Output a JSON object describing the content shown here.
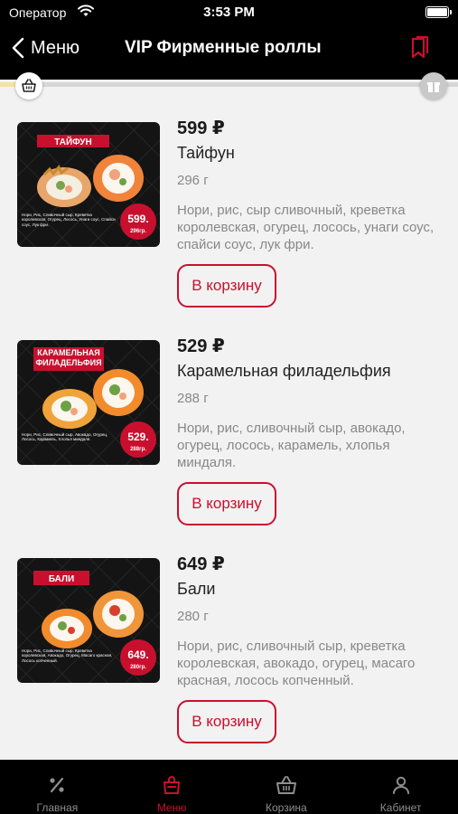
{
  "status_bar": {
    "carrier": "Оператор",
    "time": "3:53 PM"
  },
  "nav": {
    "back_label": "Меню",
    "title": "VIP Фирменные роллы"
  },
  "progress": {
    "fraction": 0.04
  },
  "accent_color": "#c8102e",
  "products": [
    {
      "price": "599 ₽",
      "name": "Тайфун",
      "weight": "296 г",
      "description": "Нори, рис, сыр сливочный, креветка королевская, огурец, лосось, унаги соус, спайси соус, лук фри.",
      "button": "В корзину",
      "image": {
        "banner": "ТАЙФУН",
        "price_badge": "599.",
        "weight_badge": "296гр.",
        "composition": "Нори, Рис, Сливочный сыр, Креветка королевская, Огурец, Лосось, Унаги соус, Спайси соус, Лук фри."
      }
    },
    {
      "price": "529 ₽",
      "name": "Карамельная филадельфия",
      "weight": "288 г",
      "description": "Нори, рис, сливочный сыр, авокадо, огурец, лосось, карамель, хлопья миндаля.",
      "button": "В корзину",
      "image": {
        "banner": "КАРАМЕЛЬНАЯ ФИЛАДЕЛЬФИЯ",
        "price_badge": "529.",
        "weight_badge": "288гр.",
        "composition": "Нори, Рис, Сливочный сыр, Авокадо, Огурец, Лосось, Карамель, Хлопья миндаля."
      }
    },
    {
      "price": "649 ₽",
      "name": "Бали",
      "weight": "280 г",
      "description": "Нори, рис, сливочный сыр, креветка королевская, авокадо, огурец, масаго красная, лосось копченный.",
      "button": "В корзину",
      "image": {
        "banner": "БАЛИ",
        "price_badge": "649.",
        "weight_badge": "280гр.",
        "composition": "Нори, Рис, Сливочный сыр, Креветка королевская, Авокадо, Огурец, Масаго красная, Лосось копченный."
      }
    }
  ],
  "tabs": [
    {
      "label": "Главная",
      "icon": "percent-icon",
      "active": false
    },
    {
      "label": "Меню",
      "icon": "menu-bag-icon",
      "active": true
    },
    {
      "label": "Корзина",
      "icon": "basket-icon",
      "active": false
    },
    {
      "label": "Кабинет",
      "icon": "user-icon",
      "active": false
    }
  ]
}
